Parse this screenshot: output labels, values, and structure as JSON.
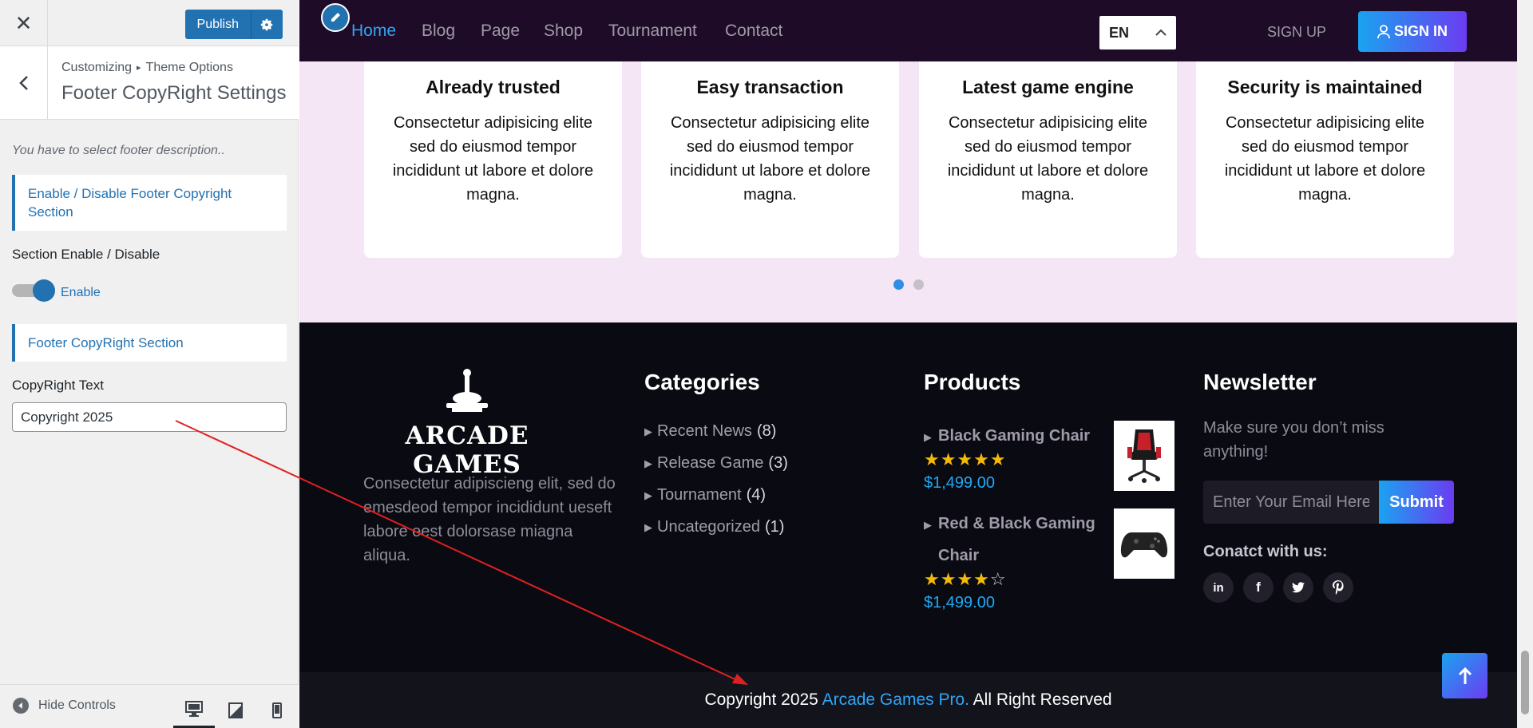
{
  "customizer": {
    "close_label": "✕",
    "publish_label": "Publish",
    "breadcrumb": {
      "root": "Customizing",
      "section": "Theme Options"
    },
    "panel_title": "Footer CopyRight Settings",
    "description": "You have to select footer description..",
    "enable_section_title": "Enable / Disable Footer Copyright Section",
    "toggle_label": "Section Enable / Disable",
    "toggle_state_text": "Enable",
    "toggle_on": true,
    "copyright_section_title": "Footer CopyRight Section",
    "copyright_text_label": "CopyRight Text",
    "copyright_text_value": "Copyright 2025",
    "hide_controls_label": "Hide Controls"
  },
  "navbar": {
    "links": [
      "Home",
      "Blog",
      "Page",
      "Shop",
      "Tournament",
      "Contact"
    ],
    "active_link": "Home",
    "language": "EN",
    "signup_label": "SIGN UP",
    "signin_label": "SIGN IN"
  },
  "features": [
    {
      "title": "Already trusted",
      "text": "Consectetur adipisicing elite sed do eiusmod tempor incididunt ut labore et dolore magna."
    },
    {
      "title": "Easy transaction",
      "text": "Consectetur adipisicing elite sed do eiusmod tempor incididunt ut labore et dolore magna."
    },
    {
      "title": "Latest game engine",
      "text": "Consectetur adipisicing elite sed do eiusmod tempor incididunt ut labore et dolore magna."
    },
    {
      "title": "Security is maintained",
      "text": "Consectetur adipisicing elite sed do eiusmod tempor incididunt ut labore et dolore magna."
    }
  ],
  "carousel": {
    "active_dot": 1,
    "total_dots": 2
  },
  "footer": {
    "logo_text": "ARCADE GAMES",
    "about": "Consectetur adipiscieng elit, sed do emesdeod tempor incididunt ueseft labore eest dolorsase miagna aliqua.",
    "categories_title": "Categories",
    "categories": [
      {
        "name": "Recent News",
        "count": "(8)"
      },
      {
        "name": "Release Game",
        "count": "(3)"
      },
      {
        "name": "Tournament",
        "count": "(4)"
      },
      {
        "name": "Uncategorized",
        "count": "(1)"
      }
    ],
    "products_title": "Products",
    "products": [
      {
        "name": "Black Gaming Chair",
        "rating": 5,
        "price": "$1,499.00"
      },
      {
        "name": "Red & Black Gaming Chair",
        "name_line1": "Red & Black Gaming",
        "name_line2": "Chair",
        "rating": 4,
        "price": "$1,499.00"
      }
    ],
    "newsletter_title": "Newsletter",
    "newsletter_text": "Make sure you don’t miss anything!",
    "email_placeholder": "Enter Your Email Here",
    "submit_label": "Submit",
    "contact_title": "Conatct with us:",
    "socials": [
      "linkedin-icon",
      "facebook-icon",
      "twitter-icon",
      "pinterest-icon"
    ],
    "copyright_prefix": "Copyright 2025",
    "copyright_brand": "Arcade Games Pro.",
    "copyright_suffix": "All Right Reserved"
  },
  "colors": {
    "accent": "#2271b1",
    "nav_bg": "#1e0b28",
    "footer_bg": "#0a0a12",
    "link_blue": "#2ea6f5",
    "star": "#f5b90a"
  }
}
